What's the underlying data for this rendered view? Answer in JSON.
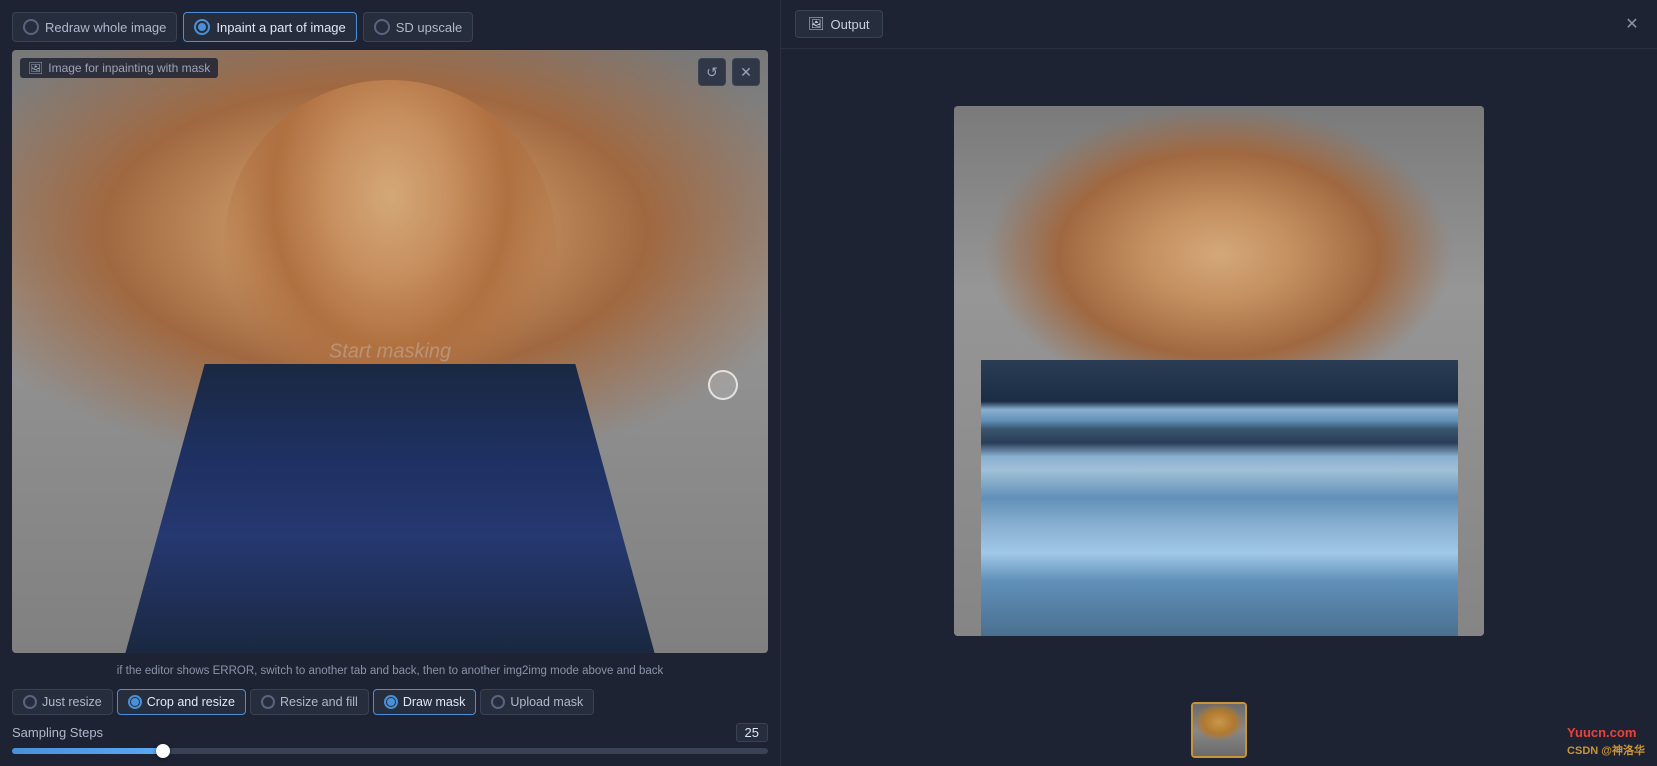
{
  "left": {
    "mode_tabs": [
      {
        "id": "redraw",
        "label": "Redraw whole image",
        "active": false
      },
      {
        "id": "inpaint",
        "label": "Inpaint a part of image",
        "active": true
      },
      {
        "id": "sd_upscale",
        "label": "SD upscale",
        "active": false
      }
    ],
    "image_label": "Image for inpainting with mask",
    "start_masking_text": "Start masking",
    "error_hint": "if the editor shows ERROR, switch to another tab and back, then to another img2img mode above and back",
    "resize_tabs": [
      {
        "id": "just_resize",
        "label": "Just resize",
        "active": false
      },
      {
        "id": "crop_resize",
        "label": "Crop and resize",
        "active": true
      },
      {
        "id": "resize_fill",
        "label": "Resize and fill",
        "active": false
      },
      {
        "id": "draw_mask",
        "label": "Draw mask",
        "active": true
      },
      {
        "id": "upload_mask",
        "label": "Upload mask",
        "active": false
      }
    ],
    "sampling": {
      "label": "Sampling Steps",
      "value": 25,
      "fill_percent": 20
    }
  },
  "right": {
    "output_tab_label": "Output",
    "output_icon": "📷",
    "close_icon": "✕",
    "watermark": "Yuucn.com",
    "watermark_sub": "CSDN @神洛华"
  },
  "icons": {
    "image_icon": "🖼",
    "reset_icon": "↺",
    "close_icon": "✕",
    "output_icon": "🖼"
  }
}
